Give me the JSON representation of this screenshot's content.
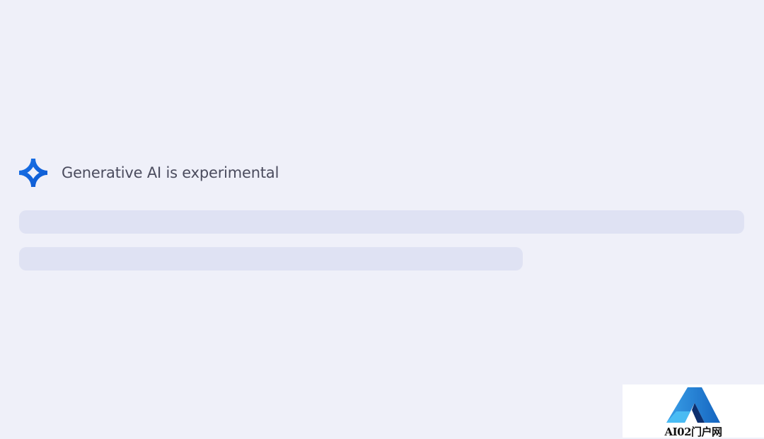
{
  "notice": {
    "icon": "sparkle-icon",
    "text": "Generative AI is experimental",
    "icon_colors": [
      "#1a73e8",
      "#0b57d0"
    ]
  },
  "skeleton": {
    "lines": 2,
    "color": "#dfe2f3"
  },
  "watermark": {
    "logo": "ai-portal-logo",
    "text": "AI02门户网"
  },
  "colors": {
    "background": "#eff0f9",
    "text": "#4b4c5e"
  }
}
